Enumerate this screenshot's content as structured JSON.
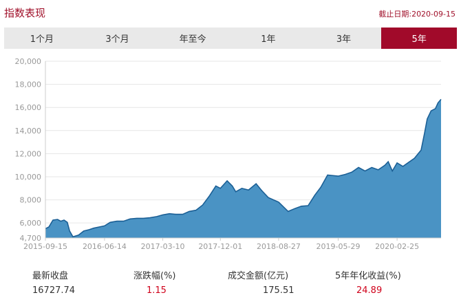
{
  "header": {
    "title": "指数表现",
    "as_of": "截止日期:2020-09-15"
  },
  "tabs": [
    {
      "label": "1个月",
      "active": false
    },
    {
      "label": "3个月",
      "active": false
    },
    {
      "label": "年至今",
      "active": false
    },
    {
      "label": "1年",
      "active": false
    },
    {
      "label": "3年",
      "active": false
    },
    {
      "label": "5年",
      "active": true
    }
  ],
  "colors": {
    "accent": "#a10a2a",
    "fill": "#4a93c4",
    "line": "#1b5f95",
    "red": "#d0021b"
  },
  "chart_data": {
    "type": "area",
    "x_ticks": [
      "2015-09-15",
      "2016-06-14",
      "2017-03-10",
      "2017-12-01",
      "2018-08-27",
      "2019-05-29",
      "2020-02-25"
    ],
    "y_ticks": [
      4700,
      6000,
      8000,
      10000,
      12000,
      14000,
      16000,
      18000,
      20000
    ],
    "y_tick_labels": [
      "4,700",
      "6,000",
      "8,000",
      "10,000",
      "12,000",
      "14,000",
      "16,000",
      "18,000",
      "20,000"
    ],
    "ylim": [
      4700,
      20000
    ],
    "grid": true,
    "series": [
      {
        "x": [
          "2015-09-15",
          "2015-10-01",
          "2015-10-20",
          "2015-11-10",
          "2015-11-25",
          "2015-12-10",
          "2015-12-25",
          "2016-01-05",
          "2016-01-20",
          "2016-02-15",
          "2016-03-10",
          "2016-04-01",
          "2016-04-25",
          "2016-05-20",
          "2016-06-14",
          "2016-07-10",
          "2016-08-10",
          "2016-09-10",
          "2016-10-10",
          "2016-11-10",
          "2016-12-10",
          "2017-01-10",
          "2017-02-10",
          "2017-03-10",
          "2017-04-10",
          "2017-05-10",
          "2017-06-10",
          "2017-07-10",
          "2017-08-10",
          "2017-09-10",
          "2017-10-10",
          "2017-11-10",
          "2017-12-01",
          "2018-01-01",
          "2018-01-25",
          "2018-02-10",
          "2018-03-10",
          "2018-04-10",
          "2018-05-15",
          "2018-06-10",
          "2018-07-10",
          "2018-08-27",
          "2018-10-10",
          "2018-11-10",
          "2018-12-10",
          "2019-01-10",
          "2019-02-10",
          "2019-03-10",
          "2019-04-10",
          "2019-05-29",
          "2019-06-30",
          "2019-07-31",
          "2019-08-31",
          "2019-09-30",
          "2019-10-31",
          "2019-11-30",
          "2019-12-31",
          "2020-01-15",
          "2020-02-03",
          "2020-02-25",
          "2020-03-23",
          "2020-04-15",
          "2020-05-15",
          "2020-06-15",
          "2020-07-01",
          "2020-07-13",
          "2020-07-31",
          "2020-08-20",
          "2020-09-01",
          "2020-09-15"
        ],
        "values": [
          5500,
          5650,
          6250,
          6300,
          6150,
          6250,
          6050,
          5300,
          4800,
          4950,
          5300,
          5400,
          5550,
          5650,
          5750,
          6050,
          6150,
          6150,
          6350,
          6400,
          6400,
          6450,
          6550,
          6700,
          6800,
          6750,
          6750,
          7000,
          7100,
          7550,
          8300,
          9200,
          9000,
          9650,
          9200,
          8700,
          9000,
          8850,
          9400,
          8800,
          8200,
          7800,
          7000,
          7250,
          7450,
          7500,
          8400,
          9100,
          10150,
          10050,
          10200,
          10400,
          10800,
          10500,
          10800,
          10600,
          11000,
          11300,
          10500,
          11200,
          10900,
          11200,
          11600,
          12300,
          13800,
          15000,
          15700,
          15900,
          16400,
          16700
        ]
      }
    ]
  },
  "stats": [
    {
      "label": "最新收盘",
      "value": "16727.74",
      "red": false
    },
    {
      "label": "涨跌幅(%)",
      "value": "1.15",
      "red": true
    },
    {
      "label": "成交金额(亿元)",
      "value": "175.51",
      "red": false
    },
    {
      "label": "5年年化收益(%)",
      "value": "24.89",
      "red": true
    }
  ]
}
